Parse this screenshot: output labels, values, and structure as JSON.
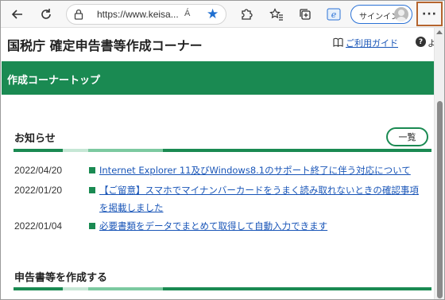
{
  "browser": {
    "url": "https://www.keisa...",
    "read_aloud": "Á",
    "signin_label": "サインイン",
    "more_label": "···"
  },
  "site": {
    "title": "国税庁  確定申告書等作成コーナー",
    "guide_link": "ご利用ガイド",
    "help_label": "よ"
  },
  "banner": {
    "title": "作成コーナートップ"
  },
  "notices": {
    "heading": "お知らせ",
    "list_button": "一覧",
    "items": [
      {
        "date": "2022/04/20",
        "text": "Internet Explorer 11及びWindows8.1のサポート終了に伴う対応について"
      },
      {
        "date": "2022/01/20",
        "text": "【ご留意】スマホでマイナンバーカードをうまく読み取れないときの確認事項",
        "text2": "を掲載しました"
      },
      {
        "date": "2022/01/04",
        "text": "必要書類をデータでまとめて取得して自動入力できます"
      }
    ]
  },
  "create": {
    "heading": "申告書等を作成する"
  },
  "colors": {
    "brand_green": "#1a8a52",
    "link_blue": "#1a56b8",
    "highlight_border": "#b5652f"
  }
}
